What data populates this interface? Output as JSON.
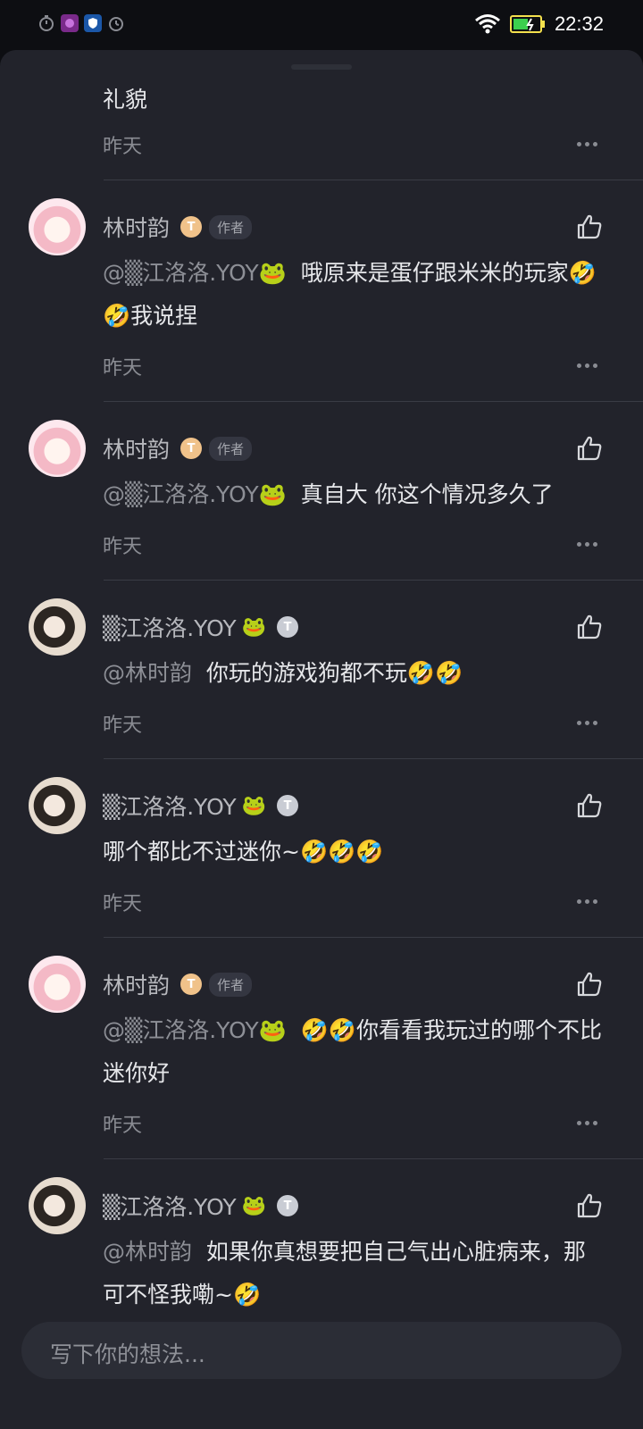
{
  "status_bar": {
    "time": "22:32",
    "icons_left": [
      "timer-icon",
      "app-purple-icon",
      "shield-app-icon",
      "alarm-icon"
    ],
    "icons_right": [
      "wifi-icon",
      "battery-icon"
    ]
  },
  "comments": [
    {
      "partial": true,
      "text": "礼貌",
      "time": "昨天"
    },
    {
      "author": "林时韵",
      "author_emoji": "",
      "level": "T",
      "badge_color": "gold",
      "author_tag": "作者",
      "mention": "@▒江洛洛.YOY🐸",
      "text": "哦原来是蛋仔跟米米的玩家🤣🤣我说捏",
      "time": "昨天"
    },
    {
      "author": "林时韵",
      "author_emoji": "",
      "level": "T",
      "badge_color": "gold",
      "author_tag": "作者",
      "mention": "@▒江洛洛.YOY🐸",
      "text": "真自大 你这个情况多久了",
      "time": "昨天"
    },
    {
      "author": "▒江洛洛.YOY",
      "author_emoji": "🐸",
      "level": "T",
      "badge_color": "silver",
      "author_tag": "",
      "mention": "@林时韵",
      "text": "你玩的游戏狗都不玩🤣🤣",
      "time": "昨天"
    },
    {
      "author": "▒江洛洛.YOY",
      "author_emoji": "🐸",
      "level": "T",
      "badge_color": "silver",
      "author_tag": "",
      "mention": "",
      "text": "哪个都比不过迷你~🤣🤣🤣",
      "time": "昨天"
    },
    {
      "author": "林时韵",
      "author_emoji": "",
      "level": "T",
      "badge_color": "gold",
      "author_tag": "作者",
      "mention": "@▒江洛洛.YOY🐸",
      "text": "🤣🤣你看看我玩过的哪个不比迷你好",
      "time": "昨天"
    },
    {
      "author": "▒江洛洛.YOY",
      "author_emoji": "🐸",
      "level": "T",
      "badge_color": "silver",
      "author_tag": "",
      "mention": "@林时韵",
      "text": "如果你真想要把自己气出心脏病来，那可不怪我嘞~🤣",
      "time": ""
    }
  ],
  "input": {
    "placeholder": "写下你的想法..."
  }
}
